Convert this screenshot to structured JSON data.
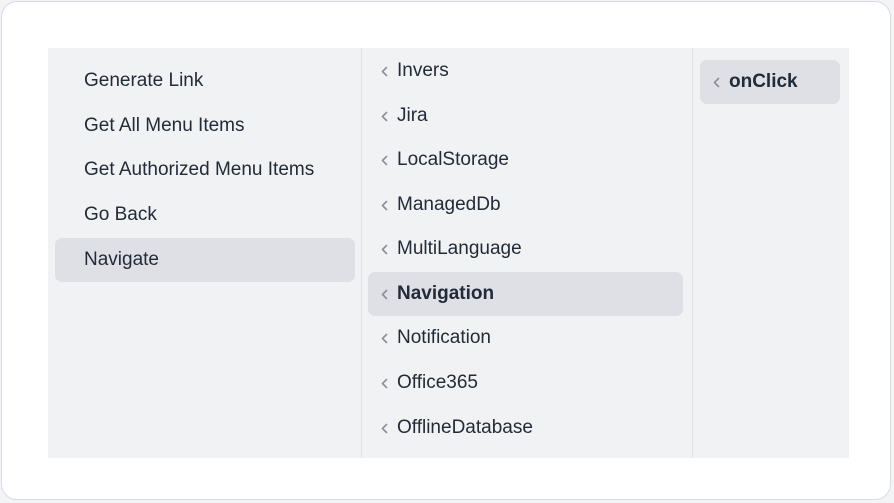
{
  "menu": {
    "column1": {
      "items": [
        {
          "label": "Generate Link"
        },
        {
          "label": "Get All Menu Items"
        },
        {
          "label": "Get Authorized Menu Items"
        },
        {
          "label": "Go Back"
        },
        {
          "label": "Navigate",
          "selected": true
        }
      ]
    },
    "column2": {
      "items": [
        {
          "label": "Invers",
          "icon": "chevron-left-icon"
        },
        {
          "label": "Jira",
          "icon": "chevron-left-icon"
        },
        {
          "label": "LocalStorage",
          "icon": "chevron-left-icon"
        },
        {
          "label": "ManagedDb",
          "icon": "chevron-left-icon"
        },
        {
          "label": "MultiLanguage",
          "icon": "chevron-left-icon"
        },
        {
          "label": "Navigation",
          "icon": "chevron-left-icon",
          "selected": true
        },
        {
          "label": "Notification",
          "icon": "chevron-left-icon"
        },
        {
          "label": "Office365",
          "icon": "chevron-left-icon"
        },
        {
          "label": "OfflineDatabase",
          "icon": "chevron-left-icon"
        }
      ]
    },
    "column3": {
      "items": [
        {
          "label": "onClick",
          "icon": "chevron-left-icon",
          "selected": true
        }
      ]
    }
  },
  "colors": {
    "menu_background": "#f1f2f4",
    "selected_background": "#dfe0e5",
    "text": "#222b38",
    "chevron": "#8a8f99"
  }
}
